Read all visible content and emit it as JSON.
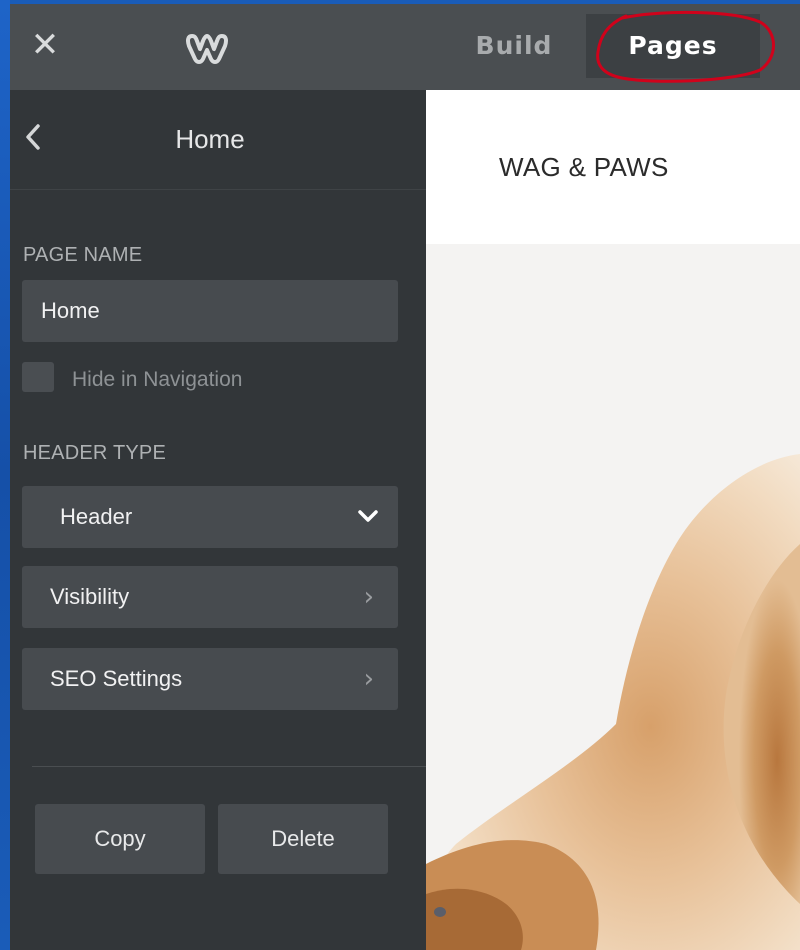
{
  "topbar": {
    "close_icon": "close-icon",
    "logo_icon": "weebly-logo-icon",
    "tabs": [
      {
        "label": "Build",
        "active": false
      },
      {
        "label": "Pages",
        "active": true
      }
    ],
    "annotation_color": "#d0021b"
  },
  "sidebar": {
    "back_icon": "chevron-left-icon",
    "title": "Home",
    "page_name_label": "PAGE NAME",
    "page_name_value": "Home",
    "hide_in_navigation_label": "Hide in Navigation",
    "hide_in_navigation_checked": false,
    "header_type_label": "HEADER TYPE",
    "header_type_value": "Header",
    "visibility_label": "Visibility",
    "seo_settings_label": "SEO Settings",
    "copy_label": "Copy",
    "delete_label": "Delete"
  },
  "preview": {
    "site_title": "WAG & PAWS",
    "hero_image": "puppy-photo"
  },
  "colors": {
    "topbar_bg": "#4a4e51",
    "sidebar_bg": "#323639",
    "field_bg": "#474b4f",
    "desktop_blue": "#1a5cb8"
  }
}
